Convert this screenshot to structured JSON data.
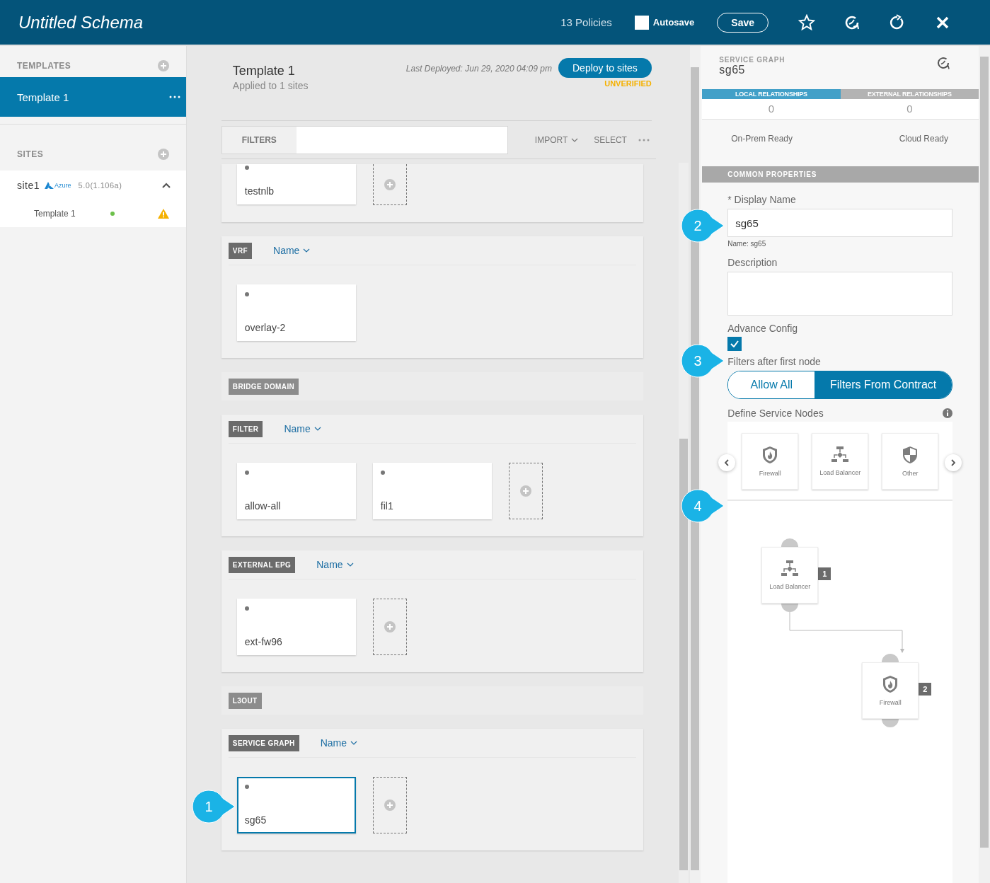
{
  "header": {
    "title": "Untitled Schema",
    "policies": "13 Policies",
    "autosave": {
      "label": "Autosave",
      "checked": false
    },
    "save_button": "Save"
  },
  "sidebar": {
    "templates_heading": "TEMPLATES",
    "templates": [
      {
        "label": "Template 1",
        "selected": true
      }
    ],
    "sites_heading": "SITES",
    "sites": [
      {
        "name": "site1",
        "cloud": "Azure",
        "version": "5.0(1.106a)",
        "expanded": true,
        "children": [
          {
            "label": "Template 1",
            "color": "#6cc04a",
            "warning": true
          }
        ]
      }
    ]
  },
  "template": {
    "title": "Template 1",
    "subtitle": "Applied to 1 sites",
    "last_deployed": "Last Deployed: Jun 29, 2020 04:09 pm",
    "deploy_button": "Deploy to sites",
    "verification": "UNVERIFIED"
  },
  "toolbar": {
    "filters_label": "FILTERS",
    "import": "IMPORT",
    "select": "SELECT"
  },
  "sections": [
    {
      "kind": "partial",
      "cards": [
        {
          "name": "testnlb",
          "selected": false
        }
      ],
      "add_tile": true
    },
    {
      "kind": "group",
      "label": "VRF",
      "sort": "Name",
      "cards": [
        {
          "name": "overlay-2",
          "selected": false
        }
      ],
      "add_tile": false
    },
    {
      "kind": "collapsed",
      "label": "BRIDGE DOMAIN"
    },
    {
      "kind": "group",
      "label": "FILTER",
      "sort": "Name",
      "cards": [
        {
          "name": "allow-all",
          "selected": false
        },
        {
          "name": "fil1",
          "selected": false
        }
      ],
      "add_tile": true
    },
    {
      "kind": "group",
      "label": "EXTERNAL EPG",
      "sort": "Name",
      "cards": [
        {
          "name": "ext-fw96",
          "selected": false
        }
      ],
      "add_tile": true
    },
    {
      "kind": "collapsed",
      "label": "L3OUT"
    },
    {
      "kind": "group",
      "label": "SERVICE GRAPH",
      "sort": "Name",
      "cards": [
        {
          "name": "sg65",
          "selected": true
        }
      ],
      "add_tile": true
    }
  ],
  "details": {
    "type_label": "SERVICE GRAPH",
    "name": "sg65",
    "tabs": [
      {
        "label": "LOCAL RELATIONSHIPS",
        "count": "0",
        "selected": true
      },
      {
        "label": "EXTERNAL RELATIONSHIPS",
        "count": "0",
        "selected": false
      }
    ],
    "readiness": [
      "On-Prem Ready",
      "Cloud Ready"
    ],
    "section_title": "COMMON PROPERTIES",
    "display_name": {
      "label": "* Display Name",
      "value": "sg65",
      "hint": "Name: sg65"
    },
    "description": {
      "label": "Description"
    },
    "advance_config": {
      "label": "Advance Config",
      "checked": true
    },
    "filters_after_first_node": {
      "label": "Filters after first node",
      "options": [
        {
          "label": "Allow All",
          "selected": false
        },
        {
          "label": "Filters From Contract",
          "selected": true
        }
      ]
    },
    "service_nodes": {
      "label": "Define Service Nodes",
      "palette": [
        {
          "kind": "firewall",
          "label": "Firewall"
        },
        {
          "kind": "load_balancer",
          "label": "Load Balancer"
        },
        {
          "kind": "other",
          "label": "Other"
        }
      ],
      "graph": [
        {
          "kind": "load_balancer",
          "label": "Load Balancer",
          "order": "1"
        },
        {
          "kind": "firewall",
          "label": "Firewall",
          "order": "2"
        }
      ]
    }
  },
  "callouts": [
    "1",
    "2",
    "3",
    "4"
  ]
}
